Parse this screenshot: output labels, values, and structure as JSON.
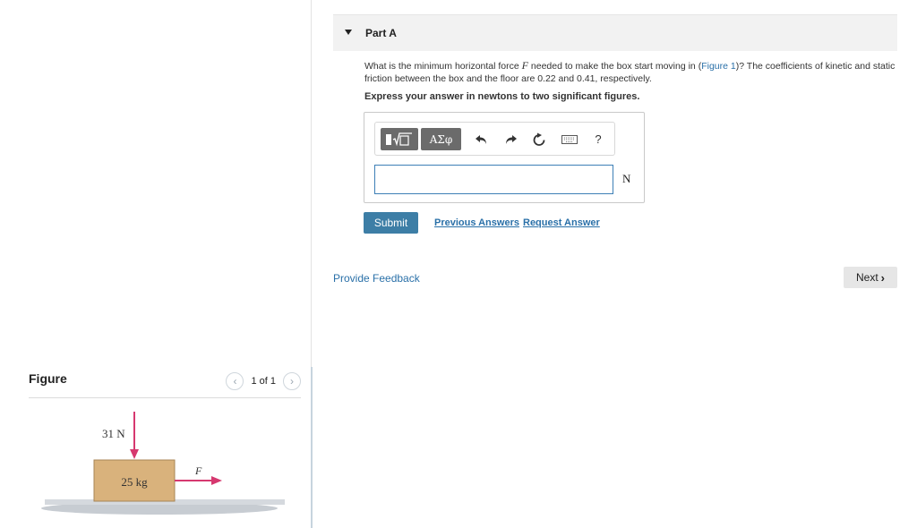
{
  "figure_panel": {
    "title": "Figure",
    "pager_text": "1 of 1",
    "diagram": {
      "normal_force_label": "31 N",
      "mass_label": "25 kg",
      "force_label": "F"
    }
  },
  "part": {
    "title": "Part A",
    "question_pre": "What is the minimum horizontal force ",
    "question_var": "F",
    "question_mid": " needed to make the box start moving in (",
    "question_link": "Figure 1",
    "question_post": ")? The coefficients of kinetic and static friction between the box and the floor are 0.22 and 0.41, respectively.",
    "instruction": "Express your answer in newtons to two significant figures.",
    "toolbar": {
      "symbols_label": "ΑΣφ",
      "help_label": "?"
    },
    "answer_value": "",
    "unit": "N",
    "submit_label": "Submit",
    "previous_answers_label": "Previous Answers",
    "request_answer_label": "Request Answer"
  },
  "footer": {
    "feedback_label": "Provide Feedback",
    "next_label": "Next"
  },
  "colors": {
    "accent_blue": "#3d7ea6",
    "link_blue": "#2a70a8",
    "force_arrow": "#d6386f",
    "box_fill": "#d9b27c"
  }
}
